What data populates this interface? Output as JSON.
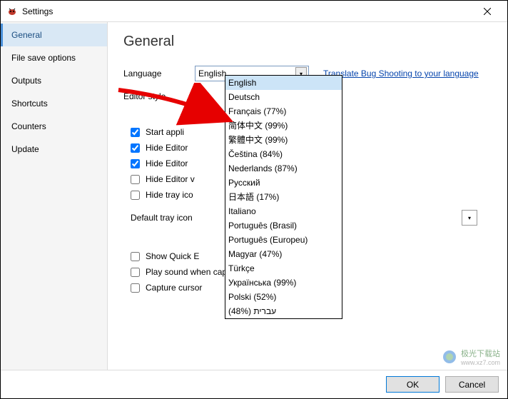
{
  "window": {
    "title": "Settings"
  },
  "sidebar": {
    "items": [
      {
        "label": "General",
        "active": true
      },
      {
        "label": "File save options",
        "active": false
      },
      {
        "label": "Outputs",
        "active": false
      },
      {
        "label": "Shortcuts",
        "active": false
      },
      {
        "label": "Counters",
        "active": false
      },
      {
        "label": "Update",
        "active": false
      }
    ]
  },
  "page": {
    "title": "General",
    "language_label": "Language",
    "language_value": "English",
    "translate_link": "Translate Bug Shooting to your language",
    "editor_style_label": "Editor style",
    "checks": [
      {
        "label": "Start appli",
        "checked": true
      },
      {
        "label": "Hide Editor",
        "checked": true
      },
      {
        "label": "Hide Editor",
        "checked": true
      },
      {
        "label": "Hide Editor v",
        "checked": false
      },
      {
        "label": "Hide tray ico",
        "checked": false
      }
    ],
    "default_tray_label": "Default tray icon",
    "checks2": [
      {
        "label": "Show Quick E",
        "checked": false
      },
      {
        "label": "Play sound when capture",
        "checked": false
      },
      {
        "label": "Capture cursor",
        "checked": false
      }
    ]
  },
  "dropdown": {
    "items": [
      "English",
      "Deutsch",
      "Français (77%)",
      "简体中文 (99%)",
      "繁體中文 (99%)",
      "Čeština (84%)",
      "Nederlands (87%)",
      "Русский",
      "日本語 (17%)",
      "Italiano",
      "Português (Brasil)",
      "Português (Europeu)",
      "Magyar (47%)",
      "Türkçe",
      "Українська (99%)",
      "Polski (52%)",
      "עברית (48%)"
    ],
    "selected_index": 0
  },
  "footer": {
    "ok": "OK",
    "cancel": "Cancel"
  },
  "watermark": {
    "name": "极光下载站",
    "url": "www.xz7.com"
  }
}
